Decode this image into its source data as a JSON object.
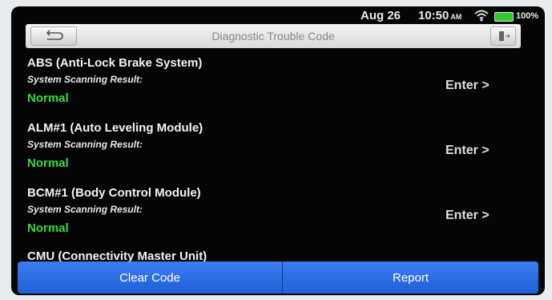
{
  "status_bar": {
    "date": "Aug 26",
    "time": "10:50",
    "ampm": "AM",
    "battery": "100%",
    "battery_color": "#2ecc2e"
  },
  "title_bar": {
    "title": "Diagnostic Trouble Code",
    "back_icon": "back-arrow-icon",
    "exit_icon": "exit-door-icon"
  },
  "systems": [
    {
      "name": "ABS (Anti-Lock Brake System)",
      "label": "System Scanning Result:",
      "status": "Normal",
      "enter": "Enter >"
    },
    {
      "name": "ALM#1 (Auto Leveling Module)",
      "label": "System Scanning Result:",
      "status": "Normal",
      "enter": "Enter >"
    },
    {
      "name": "BCM#1 (Body Control Module)",
      "label": "System Scanning Result:",
      "status": "Normal",
      "enter": "Enter >"
    },
    {
      "name": "CMU (Connectivity Master Unit)"
    }
  ],
  "bottom_bar": {
    "clear_label": "Clear Code",
    "report_label": "Report",
    "accent": "#2f6fe6"
  },
  "colors": {
    "status_normal": "#39d84a",
    "background": "#050505"
  }
}
